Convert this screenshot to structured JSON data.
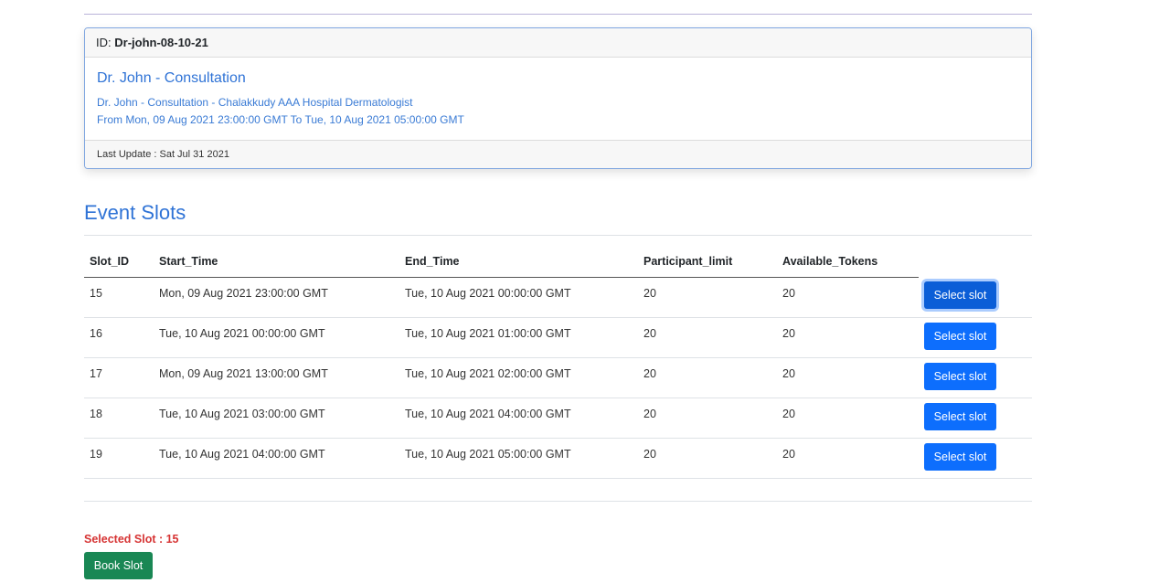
{
  "event": {
    "id_label": "ID:",
    "id_value": "Dr-john-08-10-21",
    "title": "Dr. John - Consultation",
    "description": "Dr. John - Consultation - Chalakkudy AAA Hospital Dermatologist",
    "timespan": "From Mon, 09 Aug 2021 23:00:00 GMT To Tue, 10 Aug 2021 05:00:00 GMT",
    "last_update": "Last Update : Sat Jul 31 2021"
  },
  "slots_section": {
    "title": "Event Slots",
    "columns": [
      "Slot_ID",
      "Start_Time",
      "End_Time",
      "Participant_limit",
      "Available_Tokens"
    ],
    "select_label": "Select slot",
    "rows": [
      {
        "slot_id": "15",
        "start": "Mon, 09 Aug 2021 23:00:00 GMT",
        "end": "Tue, 10 Aug 2021 00:00:00 GMT",
        "limit": "20",
        "tokens": "20"
      },
      {
        "slot_id": "16",
        "start": "Tue, 10 Aug 2021 00:00:00 GMT",
        "end": "Tue, 10 Aug 2021 01:00:00 GMT",
        "limit": "20",
        "tokens": "20"
      },
      {
        "slot_id": "17",
        "start": "Mon, 09 Aug 2021 13:00:00 GMT",
        "end": "Tue, 10 Aug 2021 02:00:00 GMT",
        "limit": "20",
        "tokens": "20"
      },
      {
        "slot_id": "18",
        "start": "Tue, 10 Aug 2021 03:00:00 GMT",
        "end": "Tue, 10 Aug 2021 04:00:00 GMT",
        "limit": "20",
        "tokens": "20"
      },
      {
        "slot_id": "19",
        "start": "Tue, 10 Aug 2021 04:00:00 GMT",
        "end": "Tue, 10 Aug 2021 05:00:00 GMT",
        "limit": "20",
        "tokens": "20"
      }
    ]
  },
  "selection": {
    "selected_text": "Selected Slot : 15",
    "book_label": "Book Slot"
  },
  "colors": {
    "accent_blue": "#2f73d6",
    "button_blue": "#0d6efd",
    "book_green": "#198754",
    "selected_red": "#d63333"
  }
}
